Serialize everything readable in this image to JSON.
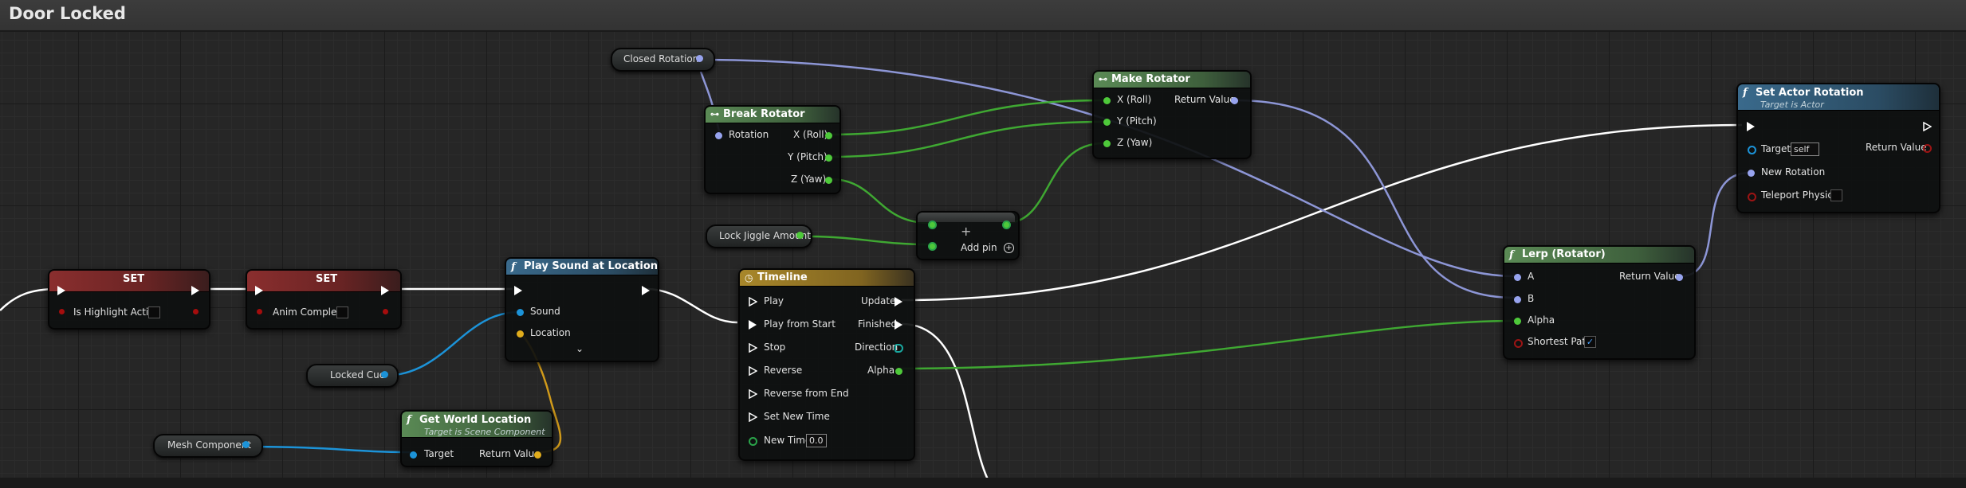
{
  "graph_title": "Door Locked",
  "variables": {
    "closed_rotation": "Closed Rotation",
    "lock_jiggle_amount": "Lock Jiggle Amount",
    "locked_cue": "Locked Cue",
    "mesh_component": "Mesh Component"
  },
  "set1": {
    "title": "SET",
    "field": "Is Highlight Active"
  },
  "set2": {
    "title": "SET",
    "field": "Anim Complete"
  },
  "play_sound": {
    "title": "Play Sound at Location",
    "sound": "Sound",
    "location": "Location"
  },
  "get_world_location": {
    "title": "Get World Location",
    "subtitle": "Target is Scene Component",
    "target": "Target",
    "return_value": "Return Value"
  },
  "break_rotator": {
    "title": "Break Rotator",
    "rotation": "Rotation",
    "x": "X (Roll)",
    "y": "Y (Pitch)",
    "z": "Z (Yaw)"
  },
  "make_rotator": {
    "title": "Make Rotator",
    "x": "X (Roll)",
    "y": "Y (Pitch)",
    "z": "Z (Yaw)",
    "return_value": "Return Value"
  },
  "add_node": {
    "symbol": "+",
    "add_pin": "Add pin"
  },
  "timeline": {
    "title": "Timeline",
    "inputs": [
      "Play",
      "Play from Start",
      "Stop",
      "Reverse",
      "Reverse from End",
      "Set New Time",
      "New Time"
    ],
    "new_time_value": "0.0",
    "outputs": {
      "update": "Update",
      "finished": "Finished",
      "direction": "Direction",
      "alpha": "Alpha"
    }
  },
  "lerp": {
    "title": "Lerp (Rotator)",
    "a": "A",
    "b": "B",
    "alpha": "Alpha",
    "shortest_path": "Shortest Path",
    "return_value": "Return Value",
    "shortest_path_checked": true
  },
  "set_actor_rotation": {
    "title": "Set Actor Rotation",
    "subtitle": "Target is Actor",
    "target": "Target",
    "target_value": "self",
    "new_rotation": "New Rotation",
    "teleport_physics": "Teleport Physics",
    "return_value": "Return Value"
  },
  "colors": {
    "exec": "#ffffff",
    "float": "#4ec93a",
    "object": "#1c93d8",
    "vector": "#e0ac1c",
    "rotator": "#97a3ee",
    "bool": "#a50d0d"
  }
}
